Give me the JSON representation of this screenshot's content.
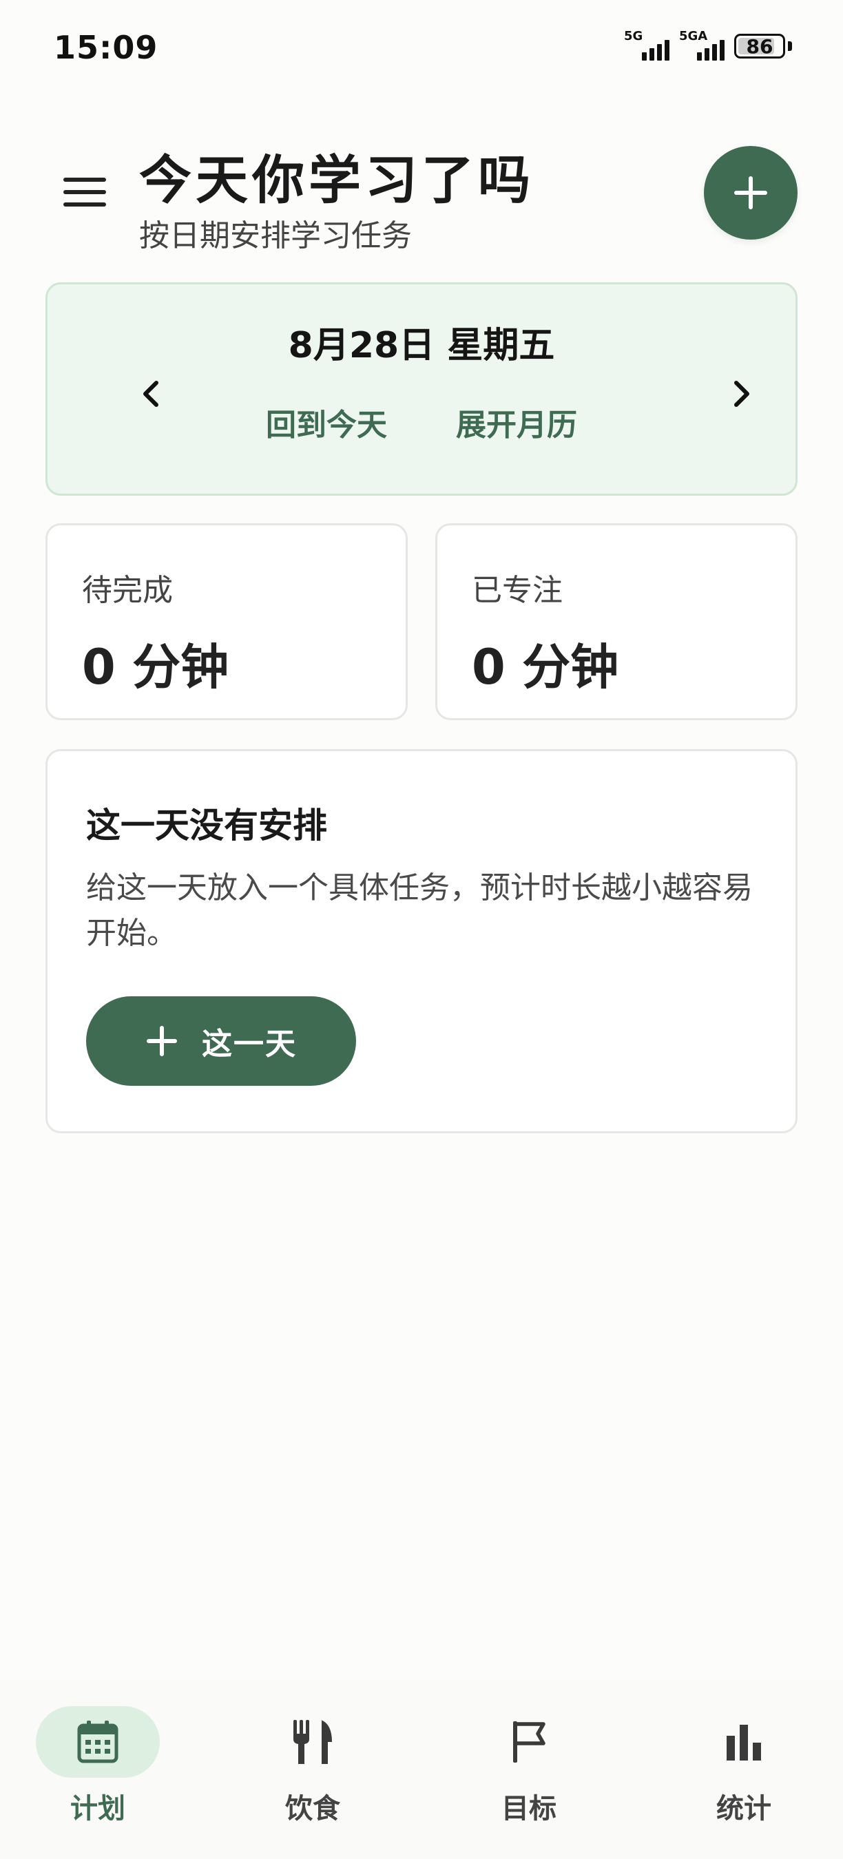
{
  "status_bar": {
    "time": "15:09",
    "network_1": "5G",
    "network_2": "5GA",
    "battery": "86",
    "battery_level": 0.86
  },
  "header": {
    "title": "今天你学习了吗",
    "subtitle": "按日期安排学习任务"
  },
  "date_card": {
    "date": "8月28日 星期五",
    "back_to_today": "回到今天",
    "expand_calendar": "展开月历"
  },
  "stats": {
    "pending_label": "待完成",
    "pending_value": "0 分钟",
    "focused_label": "已专注",
    "focused_value": "0 分钟"
  },
  "empty_state": {
    "title": "这一天没有安排",
    "description": "给这一天放入一个具体任务，预计时长越小越容易开始。",
    "button_label": "这一天"
  },
  "bottom_nav": {
    "items": [
      {
        "label": "计划",
        "icon": "calendar-icon",
        "active": true
      },
      {
        "label": "饮食",
        "icon": "utensils-icon",
        "active": false
      },
      {
        "label": "目标",
        "icon": "flag-icon",
        "active": false
      },
      {
        "label": "统计",
        "icon": "bar-chart-icon",
        "active": false
      }
    ]
  },
  "colors": {
    "accent": "#3e6b52",
    "accent_light": "#dcefe0",
    "date_card_bg": "#eef7ef",
    "date_card_border": "#cfe6d2",
    "background": "#fcfcfa"
  }
}
